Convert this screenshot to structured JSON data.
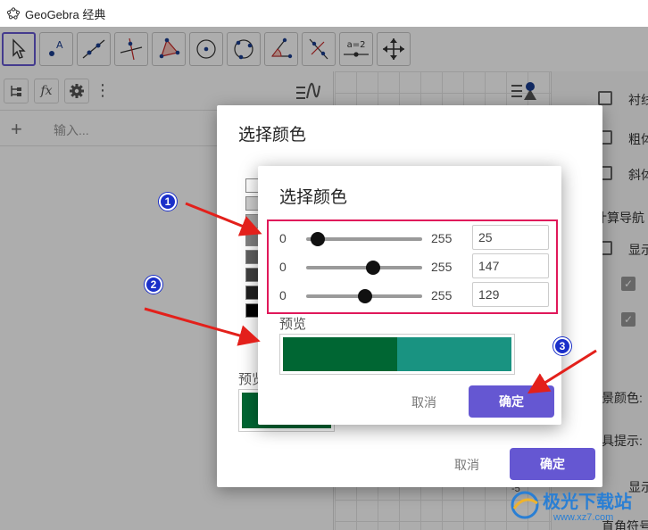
{
  "window": {
    "title": "GeoGebra 经典"
  },
  "toolbar": {
    "tools": [
      {
        "icon": "move-arrow-icon"
      },
      {
        "icon": "point-icon"
      },
      {
        "icon": "line-icon"
      },
      {
        "icon": "perpendicular-icon"
      },
      {
        "icon": "polygon-icon"
      },
      {
        "icon": "circle-center-icon"
      },
      {
        "icon": "circle-three-points-icon"
      },
      {
        "icon": "angle-icon"
      },
      {
        "icon": "reflect-icon"
      },
      {
        "icon": "slider-icon",
        "label": "a=2"
      },
      {
        "icon": "move-view-icon"
      }
    ]
  },
  "algebra": {
    "input_placeholder": "输入..."
  },
  "props": {
    "rows": [
      "衬线",
      "粗体",
      "斜体",
      "计算导航",
      "显示",
      "",
      "",
      "景颜色:",
      "具提示:",
      "显示",
      "直角符号"
    ]
  },
  "graphics": {
    "tick_label": "-5"
  },
  "outer_dialog": {
    "title": "选择颜色",
    "preview_label": "预览",
    "preview_color": "#006633",
    "cancel": "取消",
    "ok": "确定",
    "palette": [
      "#ffffff",
      "#d0d0d0",
      "#a8a8a8",
      "#808080",
      "#606060",
      "#404040",
      "#202020",
      "#000000"
    ]
  },
  "inner_dialog": {
    "title": "选择颜色",
    "sliders": [
      {
        "min": "0",
        "max": "255",
        "value": "25",
        "fraction": 0.098
      },
      {
        "min": "0",
        "max": "255",
        "value": "147",
        "fraction": 0.576
      },
      {
        "min": "0",
        "max": "255",
        "value": "129",
        "fraction": 0.506
      }
    ],
    "preview_label": "预览",
    "preview_old": "#006633",
    "preview_new": "#199381",
    "cancel": "取消",
    "ok": "确定"
  },
  "annotations": {
    "badge1": "1",
    "badge2": "2",
    "badge3": "3",
    "arrow_color": "#e3201b",
    "highlight_color": "#e0185a"
  },
  "watermark": {
    "text": "极光下载站",
    "sub": "www.xz7.com"
  }
}
